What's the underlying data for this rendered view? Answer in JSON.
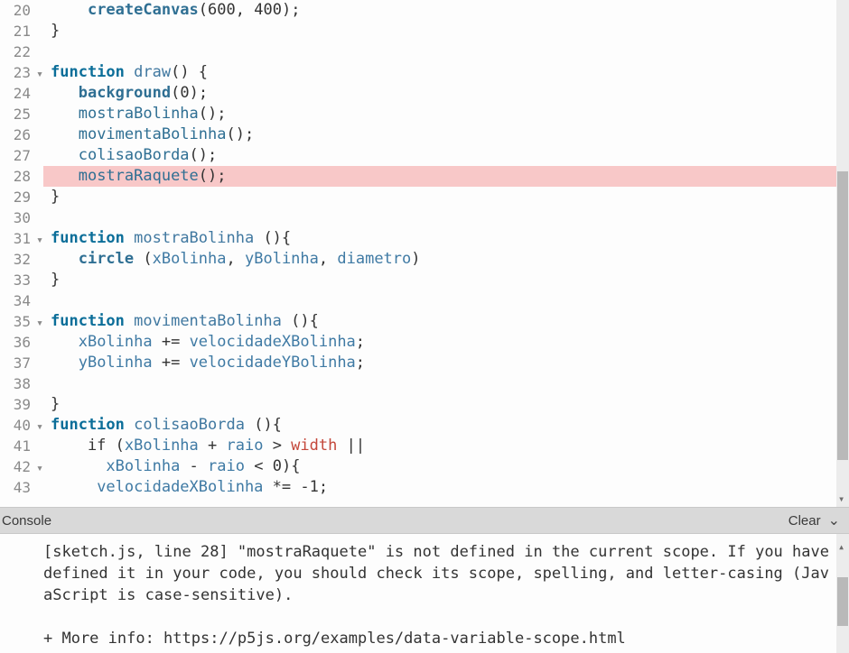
{
  "editor": {
    "highlighted_line": 28,
    "lines": [
      {
        "n": 20,
        "fold": false,
        "tokens": [
          {
            "t": "    ",
            "c": ""
          },
          {
            "t": "createCanvas",
            "c": "tok-call"
          },
          {
            "t": "(",
            "c": ""
          },
          {
            "t": "600",
            "c": "tok-num"
          },
          {
            "t": ", ",
            "c": ""
          },
          {
            "t": "400",
            "c": "tok-num"
          },
          {
            "t": ");",
            "c": ""
          }
        ]
      },
      {
        "n": 21,
        "fold": false,
        "tokens": [
          {
            "t": "}",
            "c": ""
          }
        ]
      },
      {
        "n": 22,
        "fold": false,
        "tokens": [
          {
            "t": "",
            "c": ""
          }
        ]
      },
      {
        "n": 23,
        "fold": true,
        "tokens": [
          {
            "t": "function",
            "c": "tok-kw"
          },
          {
            "t": " ",
            "c": ""
          },
          {
            "t": "draw",
            "c": "tok-def"
          },
          {
            "t": "() {",
            "c": ""
          }
        ]
      },
      {
        "n": 24,
        "fold": false,
        "tokens": [
          {
            "t": "   ",
            "c": ""
          },
          {
            "t": "background",
            "c": "tok-call"
          },
          {
            "t": "(",
            "c": ""
          },
          {
            "t": "0",
            "c": "tok-num"
          },
          {
            "t": ");",
            "c": ""
          }
        ]
      },
      {
        "n": 25,
        "fold": false,
        "tokens": [
          {
            "t": "   ",
            "c": ""
          },
          {
            "t": "mostraBolinha",
            "c": "tok-call2"
          },
          {
            "t": "();",
            "c": ""
          }
        ]
      },
      {
        "n": 26,
        "fold": false,
        "tokens": [
          {
            "t": "   ",
            "c": ""
          },
          {
            "t": "movimentaBolinha",
            "c": "tok-call2"
          },
          {
            "t": "();",
            "c": ""
          }
        ]
      },
      {
        "n": 27,
        "fold": false,
        "tokens": [
          {
            "t": "   ",
            "c": ""
          },
          {
            "t": "colisaoBorda",
            "c": "tok-call2"
          },
          {
            "t": "();",
            "c": ""
          }
        ]
      },
      {
        "n": 28,
        "fold": false,
        "tokens": [
          {
            "t": "   ",
            "c": ""
          },
          {
            "t": "mostraRaquete",
            "c": "tok-call2"
          },
          {
            "t": "();",
            "c": ""
          }
        ]
      },
      {
        "n": 29,
        "fold": false,
        "tokens": [
          {
            "t": "}",
            "c": ""
          }
        ]
      },
      {
        "n": 30,
        "fold": false,
        "tokens": [
          {
            "t": "",
            "c": ""
          }
        ]
      },
      {
        "n": 31,
        "fold": true,
        "tokens": [
          {
            "t": "function",
            "c": "tok-kw"
          },
          {
            "t": " ",
            "c": ""
          },
          {
            "t": "mostraBolinha",
            "c": "tok-def"
          },
          {
            "t": " (){",
            "c": ""
          }
        ]
      },
      {
        "n": 32,
        "fold": false,
        "tokens": [
          {
            "t": "   ",
            "c": ""
          },
          {
            "t": "circle",
            "c": "tok-call"
          },
          {
            "t": " (",
            "c": ""
          },
          {
            "t": "xBolinha",
            "c": "tok-var"
          },
          {
            "t": ", ",
            "c": ""
          },
          {
            "t": "yBolinha",
            "c": "tok-var"
          },
          {
            "t": ", ",
            "c": ""
          },
          {
            "t": "diametro",
            "c": "tok-var"
          },
          {
            "t": ")",
            "c": ""
          }
        ]
      },
      {
        "n": 33,
        "fold": false,
        "tokens": [
          {
            "t": "}",
            "c": ""
          }
        ]
      },
      {
        "n": 34,
        "fold": false,
        "tokens": [
          {
            "t": "",
            "c": ""
          }
        ]
      },
      {
        "n": 35,
        "fold": true,
        "tokens": [
          {
            "t": "function",
            "c": "tok-kw"
          },
          {
            "t": " ",
            "c": ""
          },
          {
            "t": "movimentaBolinha",
            "c": "tok-def"
          },
          {
            "t": " (){",
            "c": ""
          }
        ]
      },
      {
        "n": 36,
        "fold": false,
        "tokens": [
          {
            "t": "   ",
            "c": ""
          },
          {
            "t": "xBolinha",
            "c": "tok-var"
          },
          {
            "t": " += ",
            "c": ""
          },
          {
            "t": "velocidadeXBolinha",
            "c": "tok-var"
          },
          {
            "t": ";",
            "c": ""
          }
        ]
      },
      {
        "n": 37,
        "fold": false,
        "tokens": [
          {
            "t": "   ",
            "c": ""
          },
          {
            "t": "yBolinha",
            "c": "tok-var"
          },
          {
            "t": " += ",
            "c": ""
          },
          {
            "t": "velocidadeYBolinha",
            "c": "tok-var"
          },
          {
            "t": ";",
            "c": ""
          }
        ]
      },
      {
        "n": 38,
        "fold": false,
        "tokens": [
          {
            "t": "   ",
            "c": ""
          }
        ]
      },
      {
        "n": 39,
        "fold": false,
        "tokens": [
          {
            "t": "}",
            "c": ""
          }
        ]
      },
      {
        "n": 40,
        "fold": true,
        "tokens": [
          {
            "t": "function",
            "c": "tok-kw"
          },
          {
            "t": " ",
            "c": ""
          },
          {
            "t": "colisaoBorda",
            "c": "tok-def"
          },
          {
            "t": " (){",
            "c": ""
          }
        ]
      },
      {
        "n": 41,
        "fold": false,
        "tokens": [
          {
            "t": "    if (",
            "c": ""
          },
          {
            "t": "xBolinha",
            "c": "tok-var"
          },
          {
            "t": " + ",
            "c": ""
          },
          {
            "t": "raio",
            "c": "tok-var"
          },
          {
            "t": " > ",
            "c": ""
          },
          {
            "t": "width",
            "c": "tok-const"
          },
          {
            "t": " ||",
            "c": ""
          }
        ]
      },
      {
        "n": 42,
        "fold": true,
        "tokens": [
          {
            "t": "      ",
            "c": ""
          },
          {
            "t": "xBolinha",
            "c": "tok-var"
          },
          {
            "t": " - ",
            "c": ""
          },
          {
            "t": "raio",
            "c": "tok-var"
          },
          {
            "t": " < ",
            "c": ""
          },
          {
            "t": "0",
            "c": "tok-num"
          },
          {
            "t": "){",
            "c": ""
          }
        ]
      },
      {
        "n": 43,
        "fold": false,
        "tokens": [
          {
            "t": "     ",
            "c": ""
          },
          {
            "t": "velocidadeXBolinha",
            "c": "tok-var"
          },
          {
            "t": " *= -",
            "c": ""
          },
          {
            "t": "1",
            "c": "tok-num"
          },
          {
            "t": ";",
            "c": ""
          }
        ]
      }
    ]
  },
  "console": {
    "title": "Console",
    "clear_label": "Clear",
    "message": "[sketch.js, line 28] \"mostraRaquete\" is not defined in the current scope. If you have defined it in your code, you should check its scope, spelling, and letter-casing (JavaScript is case-sensitive).\n\n+ More info: https://p5js.org/examples/data-variable-scope.html"
  }
}
